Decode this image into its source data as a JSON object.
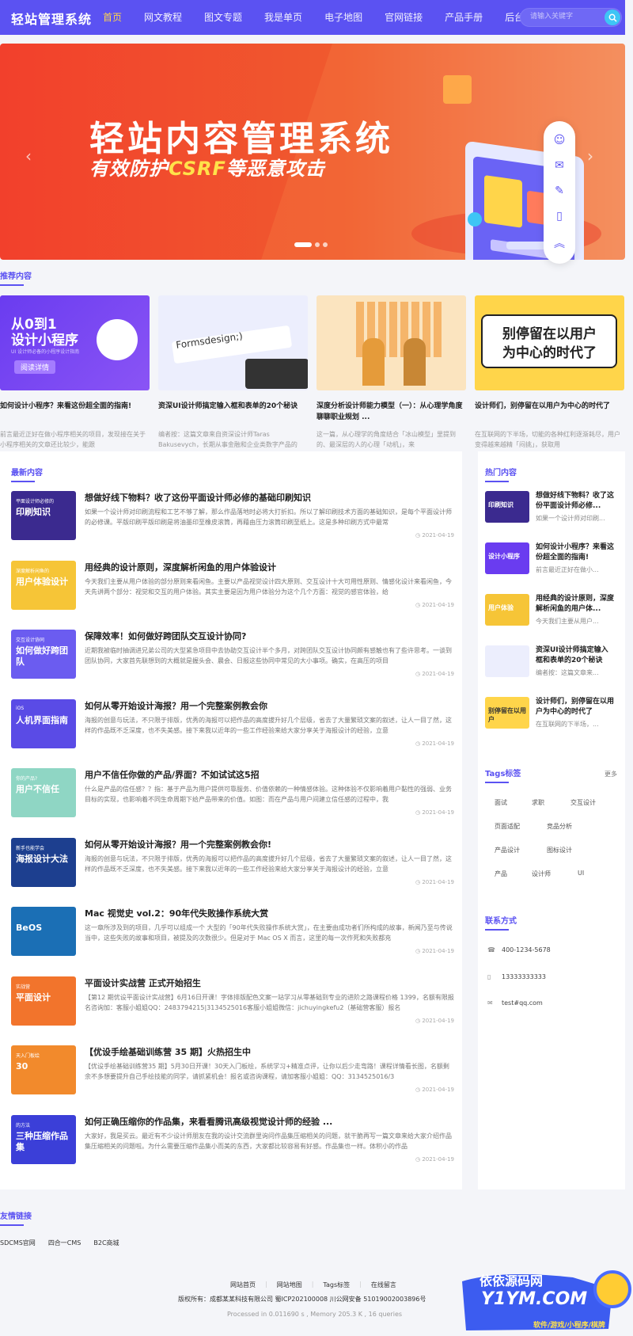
{
  "header": {
    "logo": "轻站管理系统",
    "nav": [
      "首页",
      "网文教程",
      "图文专题",
      "我是单页",
      "电子地图",
      "官网链接",
      "产品手册",
      "后台演示"
    ],
    "search_placeholder": "请输入关键字"
  },
  "banner": {
    "title": "轻站内容管理系统",
    "subtitle_pre": "有效防护",
    "subtitle_hl": "CSRF",
    "subtitle_post": "等恶意攻击"
  },
  "sections": {
    "recommend": "推荐内容",
    "latest": "最新内容",
    "hot": "热门内容",
    "tags": "Tags标签",
    "tags_more": "更多",
    "contact": "联系方式",
    "links": "友情链接"
  },
  "featured": [
    {
      "title": "如何设计小程序？来看这份超全面的指南!",
      "desc": "前言最近正好在做小程序相关的项目，发现接在关于小程序相关的文章还比较少，能跟",
      "thumb_l1": "从0到1",
      "thumb_l2": "设计小程序",
      "thumb_l3": "UI 设计师必备的小程序设计指南",
      "thumb_btn": "阅读详情"
    },
    {
      "title": "资深UI设计师搞定输入框和表单的20个秘诀",
      "desc": "编者按：这篇文章来自资深设计师Taras Bakusevych，长期从事金融和企业类数字产品的",
      "thumb_l1": "Formsdesign;)",
      "thumb_l2": "",
      "thumb_l3": "",
      "thumb_btn": ""
    },
    {
      "title": "深度分析设计师能力模型（一）：从心理学角度聊聊职业规划 ...",
      "desc": "这一篇，从心理学的角度结合「冰山模型」里提到的、最深层的人的心理「动机」，来",
      "thumb_l1": "",
      "thumb_l2": "",
      "thumb_l3": "",
      "thumb_btn": ""
    },
    {
      "title": "设计师们，别停留在以用户为中心的时代了",
      "desc": "在互联网的下半场，切能的各种红利逐渐耗尽，用户变得越来越精「闷挑」，获取用",
      "thumb_l1": "别停留在以用户",
      "thumb_l2": "为中心的时代了",
      "thumb_l3": "",
      "thumb_btn": ""
    }
  ],
  "articles": [
    {
      "title": "想做好线下物料？收了这份平面设计师必修的基础印刷知识",
      "desc": "如果一个设计师对印刷流程和工艺不够了解，那么作品落地时必将大打折扣。所以了解印刷技术方面的基础知识，是每个平面设计师的必修课。平版印刷平版印刷是将油墨印至橡皮滚筒，再藉由压力滚筒印刷至纸上。这是多种印刷方式中最常",
      "date": "2021-04-19",
      "thumb_text": "印刷知识",
      "thumb_sub": "平面设计师必修的"
    },
    {
      "title": "用经典的设计原则，深度解析闲鱼的用户体验设计",
      "desc": "今天我们主要从用户体验的部分原则来看闲鱼。主要以产品视觉设计四大原则、交互设计十大可用性原则、情感化设计来看闲鱼，今天先讲两个部分：视觉和交互的用户体验。其实主要是因为用户体验分为这个几个方面：视觉的感官体验，给",
      "date": "2021-04-19",
      "thumb_text": "用户体验设计",
      "thumb_sub": "深度解析闲鱼的"
    },
    {
      "title": "保障效率！如何做好跨团队交互设计协同?",
      "desc": "近期我被临时抽调进兄弟公司的大型紧急项目中去协助交互设计半个多月，对跨团队交互设计协同颇有感触也有了些许思考。一谈到团队协同，大家首先联想到的大概就是握头会、晨会、日报这些协同中常见的大小事项。确实，在高压的项目",
      "date": "2021-04-19",
      "thumb_text": "如何做好跨团队",
      "thumb_sub": "交互设计协同"
    },
    {
      "title": "如何从零开始设计海报？用一个完整案例教会你",
      "desc": "海报的创意与玩法，不只限于排版，优秀的海报可以把作品的高度拔升好几个层级，省去了大量繁琐文案的叙述，让人一目了然，这样的作品既不乏深度，也不失美感。接下来我以近年的一些工作经验来给大家分享关于海报设计的经验，立意",
      "date": "2021-04-19",
      "thumb_text": "人机界面指南",
      "thumb_sub": "iOS"
    },
    {
      "title": "用户不信任你做的产品/界面？不如试试这5招",
      "desc": "什么是产品的信任感？？指：基于产品为用户提供可靠服务、价值依赖的一种情感体验。这种体验不仅影响着用户黏性的强弱、业务目标的实现，也影响着不同生命周期下给产品带来的价值。如图：而在产品与用户间建立信任感的过程中，我",
      "date": "2021-04-19",
      "thumb_text": "用户不信任",
      "thumb_sub": "你的产品?"
    },
    {
      "title": "如何从零开始设计海报？用一个完整案例教会你!",
      "desc": "海报的创意与玩法，不只限于排版，优秀的海报可以把作品的高度拔升好几个层级，省去了大量繁琐文案的叙述，让人一目了然，这样的作品既不乏深度，也不失美感。接下来我以近年的一些工作经验来给大家分享关于海报设计的经验，立意",
      "date": "2021-04-19",
      "thumb_text": "海报设计大法",
      "thumb_sub": "新手也能学会"
    },
    {
      "title": "Mac 视觉史 vol.2：90年代失败操作系统大赏",
      "desc": "这一章所涉及到的项目，几乎可以组成一个 大型的「90年代失败操作系统大赏」，在主要由成功者们所构成的故事，新闻乃至与传说当中，这些失败的故事和项目，被提及的次数很少。但是对于 Mac OS X 而言，这里的每一次作死和失败都充",
      "date": "2021-04-19",
      "thumb_text": "BeOS",
      "thumb_sub": ""
    },
    {
      "title": "平面设计实战营 正式开始招生",
      "desc": "【第12 期优设平面设计实战营】6月16日开课！字体排版配色文案一站学习从零基础到专业的进阶之路课程价格 1399，名额有限报名咨询加：客服小姐姐QQ：2483794215|3134525016客服小姐姐微信：jichuyingkefu2（基础营客服）报名",
      "date": "2021-04-19",
      "thumb_text": "平面设计",
      "thumb_sub": "实战营"
    },
    {
      "title": "【优设手绘基础训练营 35 期】火热招生中",
      "desc": "【优设手绘基础训练营35 期】5月30日开课！30天入门板绘，系统学习+精准点评，让你以后少走弯路！课程详情看长图，名额剩余不多想要提升自己手绘技能的同学，请抓紧机会！报名或咨询课程，请加客服小姐姐：QQ：3134525016/3",
      "date": "2021-04-19",
      "thumb_text": "30",
      "thumb_sub": "天入门板绘"
    },
    {
      "title": "如何正确压缩你的作品集，来看看腾讯高级视觉设计师的经验 ...",
      "desc": "大家好，我是买云。最近有不少设计师朋友在我的设计交流群里询问作品集压缩相关的问题，就干脆再写一篇文章来给大家介绍作品集压缩相关的问题啦。为什么需要压缩作品集小而美的东西，大家都比较容易有好感。作品集也一样。体积小的作品",
      "date": "2021-04-19",
      "thumb_text": "三种压缩作品集",
      "thumb_sub": "的方法"
    }
  ],
  "hot": [
    {
      "title": "想做好线下物料？收了这份平面设计师必修...",
      "desc": "如果一个设计师对印刷...",
      "thumb_text": "印刷知识"
    },
    {
      "title": "如何设计小程序？来看这份超全面的指南!",
      "desc": "前言最近正好在做小...",
      "thumb_text": "设计小程序"
    },
    {
      "title": "用经典的设计原则，深度解析闲鱼的用户体...",
      "desc": "今天我们主要从用户...",
      "thumb_text": "用户体验"
    },
    {
      "title": "资深UI设计师搞定输入框和表单的20个秘诀",
      "desc": "编者按：这篇文章来...",
      "thumb_text": ""
    },
    {
      "title": "设计师们，别停留在以用户为中心的时代了",
      "desc": "在互联网的下半场，...",
      "thumb_text": "别停留在以用户"
    }
  ],
  "tags": [
    "面试",
    "求职",
    "交互设计",
    "页面适配",
    "竞品分析",
    "产品设计",
    "图标设计",
    "产品",
    "设计师",
    "UI"
  ],
  "contact": {
    "phone": "400-1234-5678",
    "mobile": "13333333333",
    "email": "test#qq.com"
  },
  "links": [
    "SDCMS官网",
    "四合一CMS",
    "B2C商城"
  ],
  "footer": {
    "nav": [
      "网站首页",
      "网站地图",
      "Tags标签",
      "在线留言"
    ],
    "copyright": "版权所有：成都某某科技有限公司   蜀ICP202100008   川公网安备 51019002003896号",
    "processed": "Processed in 0.011690 s , Memory 205.3 K , 16 queries"
  },
  "watermark": {
    "l1": "依依源码网",
    "l2": "Y1YM.COM",
    "l3": "软件/游戏/小程序/棋牌"
  },
  "colors": {
    "primary": "#5b52f2",
    "banner_red": "#f2402c",
    "accent_yellow": "#ffd54a"
  }
}
